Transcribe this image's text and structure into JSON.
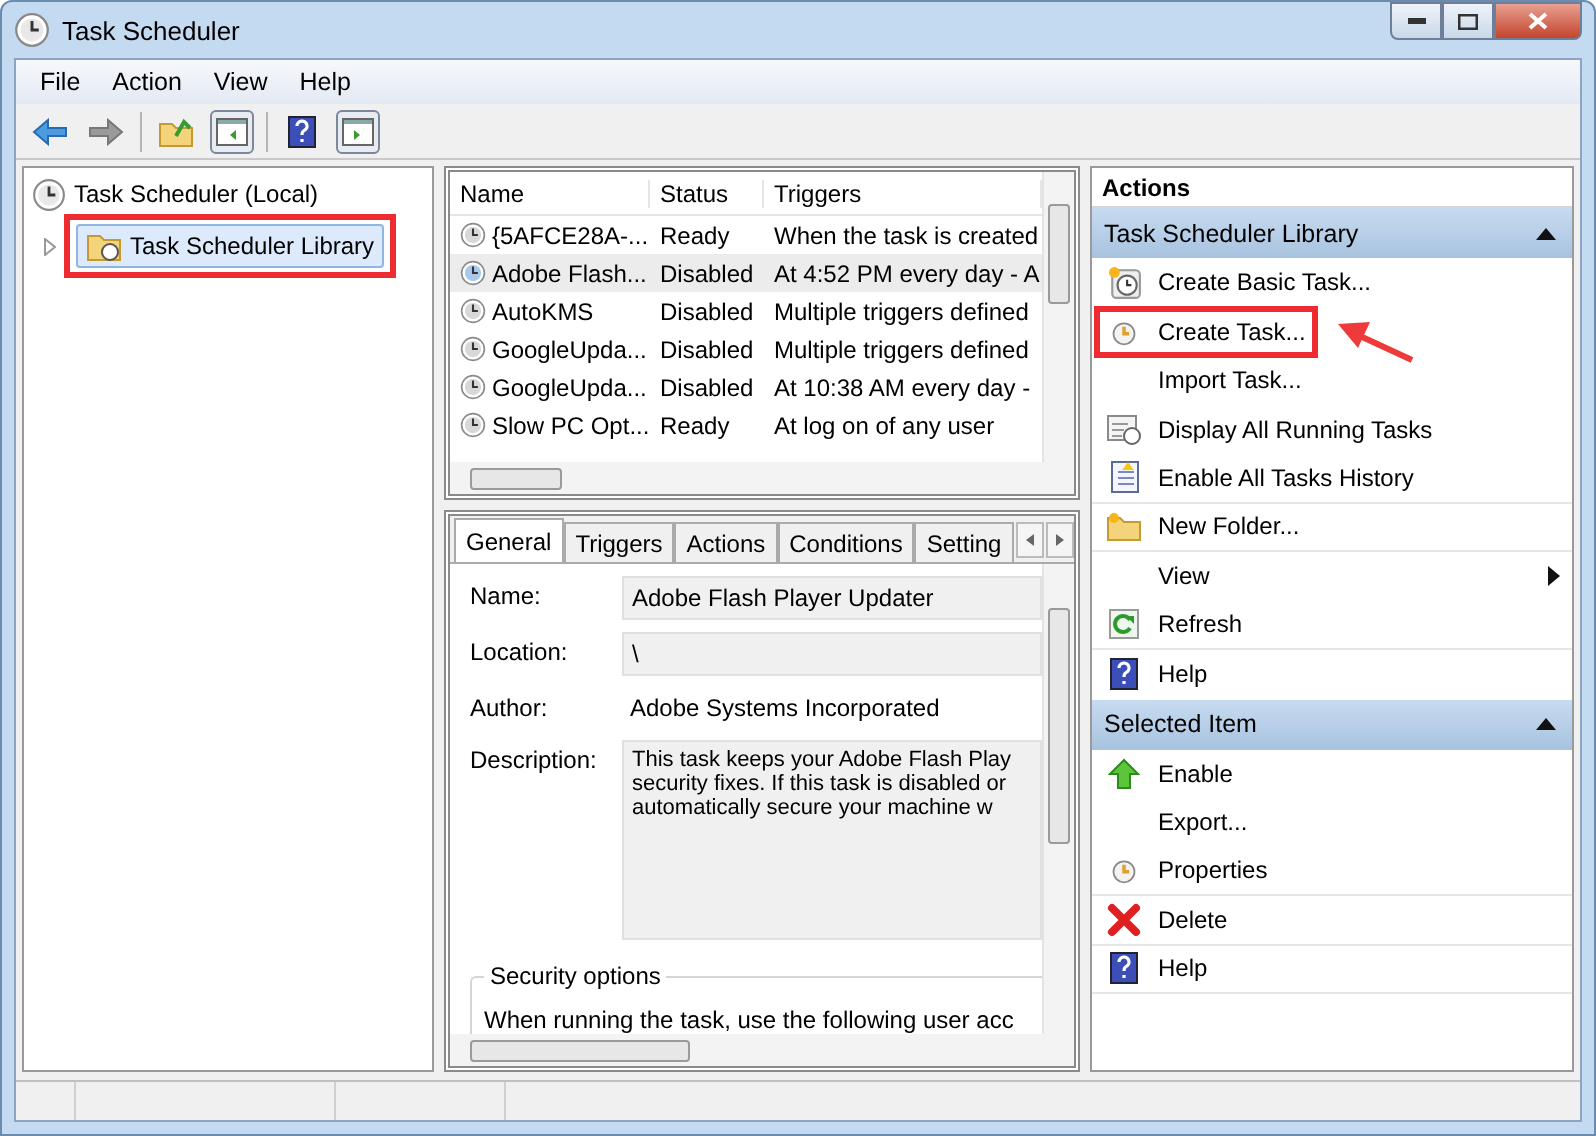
{
  "window": {
    "title": "Task Scheduler"
  },
  "menu": [
    "File",
    "Action",
    "View",
    "Help"
  ],
  "tree": {
    "label": "Task Scheduler (Local)",
    "children": [
      {
        "label": "Task Scheduler Library",
        "selected": true,
        "highlighted": true
      }
    ]
  },
  "tasks": {
    "columns": [
      "Name",
      "Status",
      "Triggers"
    ],
    "rows": [
      {
        "name": "{5AFCE28A-...",
        "status": "Ready",
        "triggers": "When the task is created",
        "selected": false
      },
      {
        "name": "Adobe Flash...",
        "status": "Disabled",
        "triggers": "At 4:52 PM every day - A",
        "selected": true
      },
      {
        "name": "AutoKMS",
        "status": "Disabled",
        "triggers": "Multiple triggers defined",
        "selected": false
      },
      {
        "name": "GoogleUpda...",
        "status": "Disabled",
        "triggers": "Multiple triggers defined",
        "selected": false
      },
      {
        "name": "GoogleUpda...",
        "status": "Disabled",
        "triggers": "At 10:38 AM every day -",
        "selected": false
      },
      {
        "name": "Slow PC Opt...",
        "status": "Ready",
        "triggers": "At log on of any user",
        "selected": false
      }
    ]
  },
  "detail_tabs": [
    {
      "label": "General",
      "selected": true
    },
    {
      "label": "Triggers",
      "selected": false
    },
    {
      "label": "Actions",
      "selected": false
    },
    {
      "label": "Conditions",
      "selected": false
    },
    {
      "label": "Setting",
      "selected": false
    }
  ],
  "general": {
    "name_label": "Name:",
    "name_value": "Adobe Flash Player Updater",
    "location_label": "Location:",
    "location_value": "\\",
    "author_label": "Author:",
    "author_value": "Adobe Systems Incorporated",
    "description_label": "Description:",
    "description_lines": [
      "This task keeps your Adobe Flash Play",
      "security fixes. If this task is disabled or",
      "automatically secure your machine w"
    ],
    "security_title": "Security options",
    "security_text": "When running the task, use the following user acc"
  },
  "actions": {
    "title": "Actions",
    "sections": [
      {
        "title": "Task Scheduler Library",
        "expanded": true,
        "items": [
          {
            "label": "Create Basic Task...",
            "highlighted": false,
            "submenu": false
          },
          {
            "label": "Create Task...",
            "highlighted": true,
            "submenu": false
          },
          {
            "label": "Import Task...",
            "highlighted": false,
            "submenu": false
          },
          {
            "label": "Display All Running Tasks",
            "highlighted": false,
            "submenu": false
          },
          {
            "label": "Enable All Tasks History",
            "highlighted": false,
            "submenu": false
          },
          {
            "label": "New Folder...",
            "highlighted": false,
            "submenu": false
          },
          {
            "label": "View",
            "highlighted": false,
            "submenu": true
          },
          {
            "label": "Refresh",
            "highlighted": false,
            "submenu": false
          },
          {
            "label": "Help",
            "highlighted": false,
            "submenu": false
          }
        ]
      },
      {
        "title": "Selected Item",
        "expanded": true,
        "items": [
          {
            "label": "Enable",
            "highlighted": false,
            "submenu": false
          },
          {
            "label": "Export...",
            "highlighted": false,
            "submenu": false
          },
          {
            "label": "Properties",
            "highlighted": false,
            "submenu": false
          },
          {
            "label": "Delete",
            "highlighted": false,
            "submenu": false
          },
          {
            "label": "Help",
            "highlighted": false,
            "submenu": false
          }
        ]
      }
    ]
  }
}
